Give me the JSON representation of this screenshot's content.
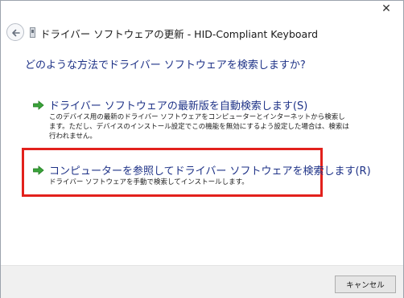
{
  "titlebar": {
    "close_glyph": "✕",
    "title": "ドライバー ソフトウェアの更新 - HID-Compliant Keyboard"
  },
  "main": {
    "question": "どのような方法でドライバー ソフトウェアを検索しますか?",
    "options": [
      {
        "title": "ドライバー ソフトウェアの最新版を自動検索します(S)",
        "description": "このデバイス用の最新のドライバー ソフトウェアをコンピューターとインターネットから検索します。ただし、デバイスのインストール設定でこの機能を無効にするよう設定した場合は、検索は行われません。",
        "icon": "green-arrow-icon",
        "highlighted": false
      },
      {
        "title": "コンピューターを参照してドライバー ソフトウェアを検索します(R)",
        "description": "ドライバー ソフトウェアを手動で検索してインストールします。",
        "icon": "green-arrow-icon",
        "highlighted": true
      }
    ],
    "highlight_color": "#e2211c",
    "accent_text_color": "#1e3287"
  },
  "footer": {
    "cancel_label": "キャンセル"
  }
}
